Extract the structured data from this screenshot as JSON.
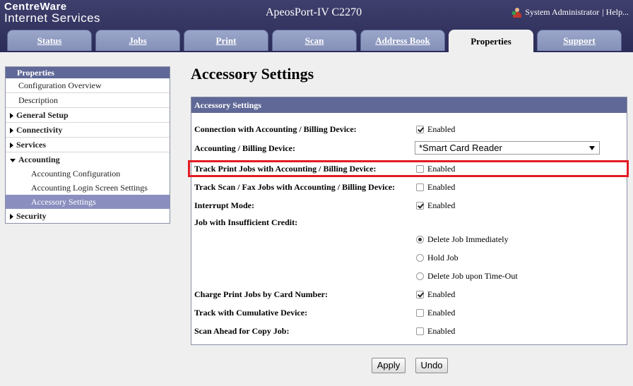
{
  "header": {
    "logo_line1": "CentreWare",
    "logo_line2": "Internet Services",
    "product": "ApeosPort-IV C2270",
    "user": "System Administrator",
    "help": "| Help..."
  },
  "tabs": [
    {
      "label": "Status"
    },
    {
      "label": "Jobs"
    },
    {
      "label": "Print"
    },
    {
      "label": "Scan"
    },
    {
      "label": "Address Book"
    },
    {
      "label": "Properties"
    },
    {
      "label": "Support"
    }
  ],
  "sidebar": {
    "title": "Properties",
    "items": [
      "Configuration Overview",
      "Description",
      "General Setup",
      "Connectivity",
      "Services",
      "Accounting",
      "Accounting Configuration",
      "Accounting Login Screen Settings",
      "Accessory Settings",
      "Security"
    ]
  },
  "main": {
    "title": "Accessory Settings",
    "panel_title": "Accessory Settings",
    "enabled": "Enabled",
    "rows": {
      "connection": "Connection with Accounting / Billing Device:",
      "device": "Accounting / Billing Device:",
      "track_print": "Track Print Jobs with Accounting / Billing Device:",
      "track_scan": "Track Scan / Fax Jobs with Accounting / Billing Device:",
      "interrupt": "Interrupt Mode:",
      "insufficient": "Job with Insufficient Credit:",
      "charge_print": "Charge Print Jobs by Card Number:",
      "track_cumulative": "Track with Cumulative Device:",
      "scan_ahead": "Scan Ahead for Copy Job:"
    },
    "device_value": "*Smart Card Reader",
    "radio_options": [
      "Delete Job Immediately",
      "Hold Job",
      "Delete Job upon Time-Out"
    ],
    "checked": {
      "connection": true,
      "track_print": false,
      "track_scan": false,
      "interrupt": true,
      "charge_print": true,
      "track_cumulative": false,
      "scan_ahead": false
    },
    "selected_radio": "Delete Job Immediately",
    "highlight_color": "#e31b23"
  },
  "buttons": {
    "apply": "Apply",
    "undo": "Undo"
  }
}
